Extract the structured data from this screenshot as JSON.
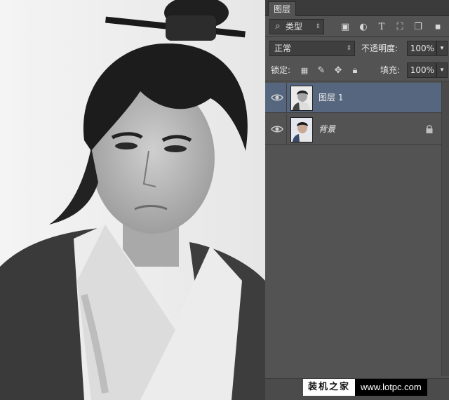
{
  "panel": {
    "tab_title": "图层",
    "filter": {
      "label": "类型"
    },
    "blend_mode": "正常",
    "opacity": {
      "label": "不透明度:",
      "value": "100%"
    },
    "lock_label": "锁定:",
    "fill": {
      "label": "填充:",
      "value": "100%"
    },
    "layers": [
      {
        "name": "图层 1",
        "selected": true,
        "locked": false
      },
      {
        "name": "背景",
        "selected": false,
        "locked": true
      }
    ]
  },
  "watermark": {
    "text_left": "装机之家",
    "text_right": "www.lotpc.com"
  },
  "colors": {
    "panel_bg": "#535353",
    "selected_layer": "#56667e",
    "control_bg": "#3f3f3f"
  },
  "icons": [
    "search-icon",
    "image-filter-icon",
    "adjustment-filter-icon",
    "type-filter-icon",
    "shape-filter-icon",
    "smart-object-filter-icon",
    "lock-pixels-icon",
    "lock-brush-icon",
    "lock-move-icon",
    "lock-all-icon",
    "eye-icon",
    "lock-icon"
  ]
}
